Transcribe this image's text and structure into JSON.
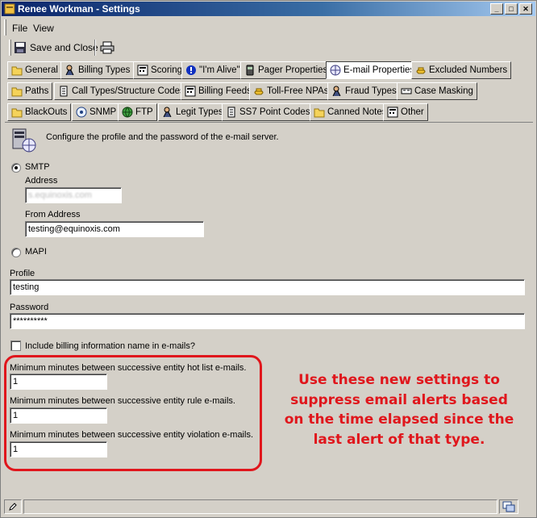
{
  "window": {
    "title": "Renee Workman - Settings"
  },
  "menu": {
    "file": "File",
    "view": "View"
  },
  "toolbar": {
    "save_close": "Save and Close"
  },
  "tabs": {
    "row1": [
      "General",
      "Billing Types",
      "Scoring",
      "\"I'm Alive\"",
      "Pager Properties",
      "E-mail Properties",
      "Excluded Numbers"
    ],
    "row2": [
      "Paths",
      "Call Types/Structure Codes",
      "Billing Feeds",
      "Toll-Free NPAs",
      "Fraud Types",
      "Case Masking"
    ],
    "row3": [
      "BlackOuts",
      "SNMP",
      "FTP",
      "Legit Types",
      "SS7 Point Codes",
      "Canned Notes",
      "Other"
    ],
    "active": "E-mail Properties"
  },
  "form": {
    "description": "Configure the profile and the password of the e-mail server.",
    "smtp_label": "SMTP",
    "address_label": "Address",
    "address_value": "s.equinoxis.com",
    "from_label": "From Address",
    "from_value": "testing@equinoxis.com",
    "mapi_label": "MAPI",
    "profile_label": "Profile",
    "profile_value": "testing",
    "password_label": "Password",
    "password_value": "**********",
    "include_billing_label": "Include billing information name in e-mails?",
    "hotlist_label": "Minimum minutes between successive entity hot list e-mails.",
    "hotlist_value": "1",
    "rule_label": "Minimum minutes between successive entity rule e-mails.",
    "rule_value": "1",
    "violation_label": "Minimum minutes between successive entity violation e-mails.",
    "violation_value": "1"
  },
  "annotation": {
    "line1": "Use these new settings to",
    "line2": "suppress email alerts based",
    "line3": "on the time elapsed since the",
    "line4": "last alert of that type."
  },
  "colors": {
    "annotation": "#e0161c",
    "titlebar": "#0a246a"
  }
}
